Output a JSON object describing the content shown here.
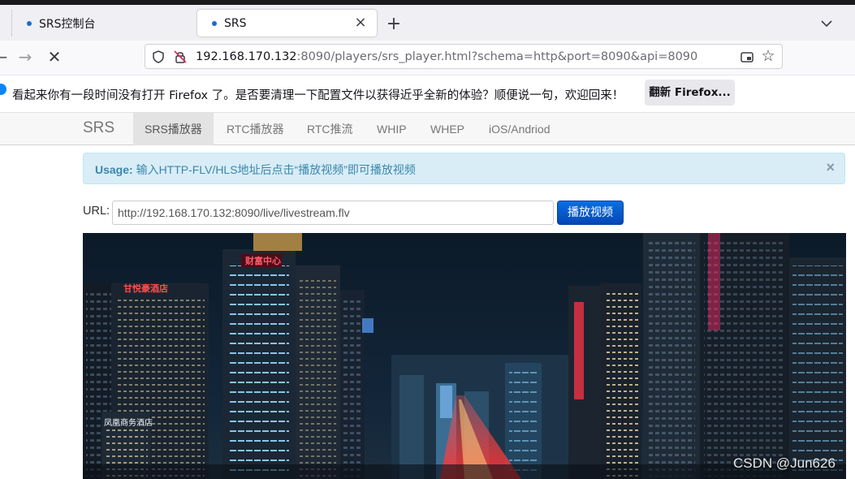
{
  "browser": {
    "tabs": [
      {
        "title": "SRS控制台",
        "active": false
      },
      {
        "title": "SRS",
        "active": true
      }
    ],
    "new_tab": "+",
    "close_glyph": "×",
    "back_glyph": "←",
    "forward_glyph": "→",
    "stop_glyph": "✕",
    "address": {
      "host": "192.168.170.132",
      "rest": ":8090/players/srs_player.html?schema=http&port=8090&api=8090"
    },
    "bookmark_glyph": "☆"
  },
  "notification": {
    "message": "看起来你有一段时间没有打开 Firefox 了。是否要清理一下配置文件以获得近乎全新的体验？顺便说一句，欢迎回来！",
    "button": "翻新 Firefox..."
  },
  "nav": {
    "brand": "SRS",
    "items": [
      "SRS播放器",
      "RTC播放器",
      "RTC推流",
      "WHIP",
      "WHEP",
      "iOS/Andriod"
    ],
    "active_index": 0
  },
  "alert": {
    "strong": "Usage:",
    "text": " 输入HTTP-FLV/HLS地址后点击“播放视频”即可播放视频",
    "close": "×"
  },
  "player": {
    "url_label": "URL:",
    "url_value": "http://192.168.170.132:8090/live/livestream.flv",
    "play_button": "播放视频"
  },
  "video_signs": {
    "left_building": "甘悦豪酒店",
    "center_tower": "财富中心",
    "lower_left": "凤凰商务酒店"
  },
  "watermark": "CSDN @Jun626",
  "colors": {
    "tab_bar": "#f0f0f4",
    "alert_bg": "#d9edf7",
    "alert_text": "#3a87ad",
    "play_button": "#0a5ad0",
    "notification_dot": "#0a84ff"
  }
}
